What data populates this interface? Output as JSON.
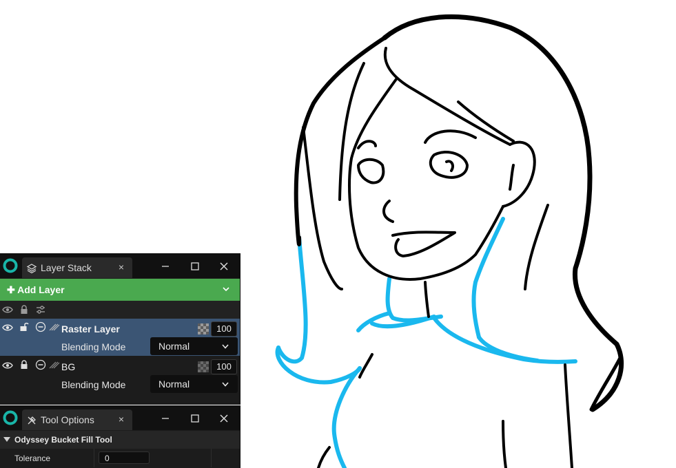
{
  "canvas": {
    "line_color": "#000000",
    "fill_color": "#1ab8ee"
  },
  "layer_stack": {
    "title": "Layer Stack",
    "close": "×",
    "add_layer": "Add Layer",
    "layers": [
      {
        "name": "Raster Layer",
        "opacity": "100",
        "blending_label": "Blending Mode",
        "blending_value": "Normal",
        "selected": true
      },
      {
        "name": "BG",
        "opacity": "100",
        "blending_label": "Blending Mode",
        "blending_value": "Normal",
        "selected": false
      }
    ]
  },
  "tool_options": {
    "title": "Tool Options",
    "close": "×",
    "section": "Odyssey Bucket Fill Tool",
    "tolerance_label": "Tolerance",
    "tolerance_value": "0"
  },
  "colors": {
    "accent_green": "#4aa94f",
    "selection_blue": "#3b5574",
    "logo_teal": "#19b5a8",
    "panel_bg": "#1c1c1c"
  }
}
